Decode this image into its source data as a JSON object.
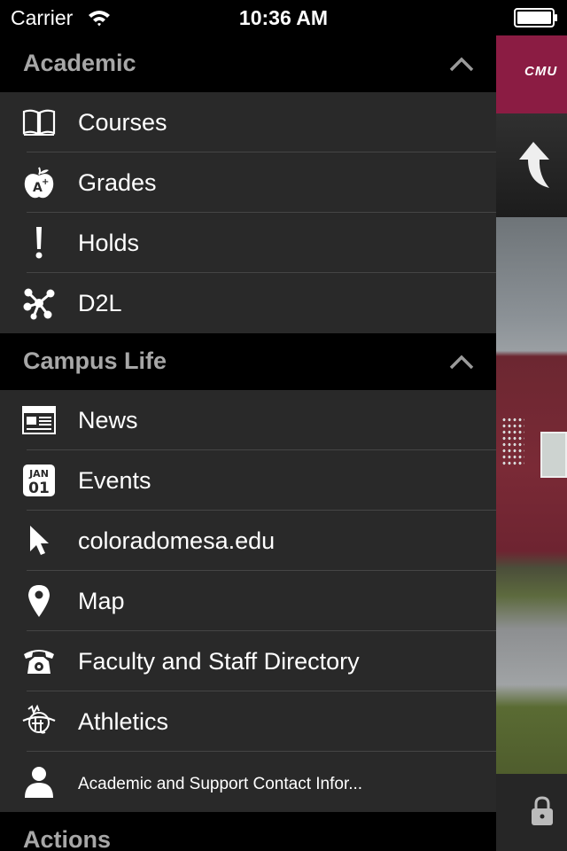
{
  "status_bar": {
    "carrier": "Carrier",
    "time": "10:36 AM"
  },
  "brand": {
    "logo_text": "CMU",
    "color": "#8b1c43"
  },
  "menu": {
    "sections": [
      {
        "title": "Academic",
        "expanded": true,
        "items": [
          {
            "label": "Courses",
            "icon": "book-icon"
          },
          {
            "label": "Grades",
            "icon": "apple-icon"
          },
          {
            "label": "Holds",
            "icon": "exclamation-icon"
          },
          {
            "label": "D2L",
            "icon": "network-icon"
          }
        ]
      },
      {
        "title": "Campus Life",
        "expanded": true,
        "items": [
          {
            "label": "News",
            "icon": "newspaper-icon"
          },
          {
            "label": "Events",
            "icon": "calendar-icon",
            "calendar_month": "JAN",
            "calendar_day": "01"
          },
          {
            "label": "coloradomesa.edu",
            "icon": "cursor-icon"
          },
          {
            "label": "Map",
            "icon": "map-pin-icon"
          },
          {
            "label": "Faculty and Staff Directory",
            "icon": "telephone-icon"
          },
          {
            "label": "Athletics",
            "icon": "athletics-logo-icon"
          },
          {
            "label": "Academic and Support Contact Infor...",
            "icon": "person-icon"
          }
        ]
      },
      {
        "title": "Actions",
        "items": []
      }
    ]
  }
}
